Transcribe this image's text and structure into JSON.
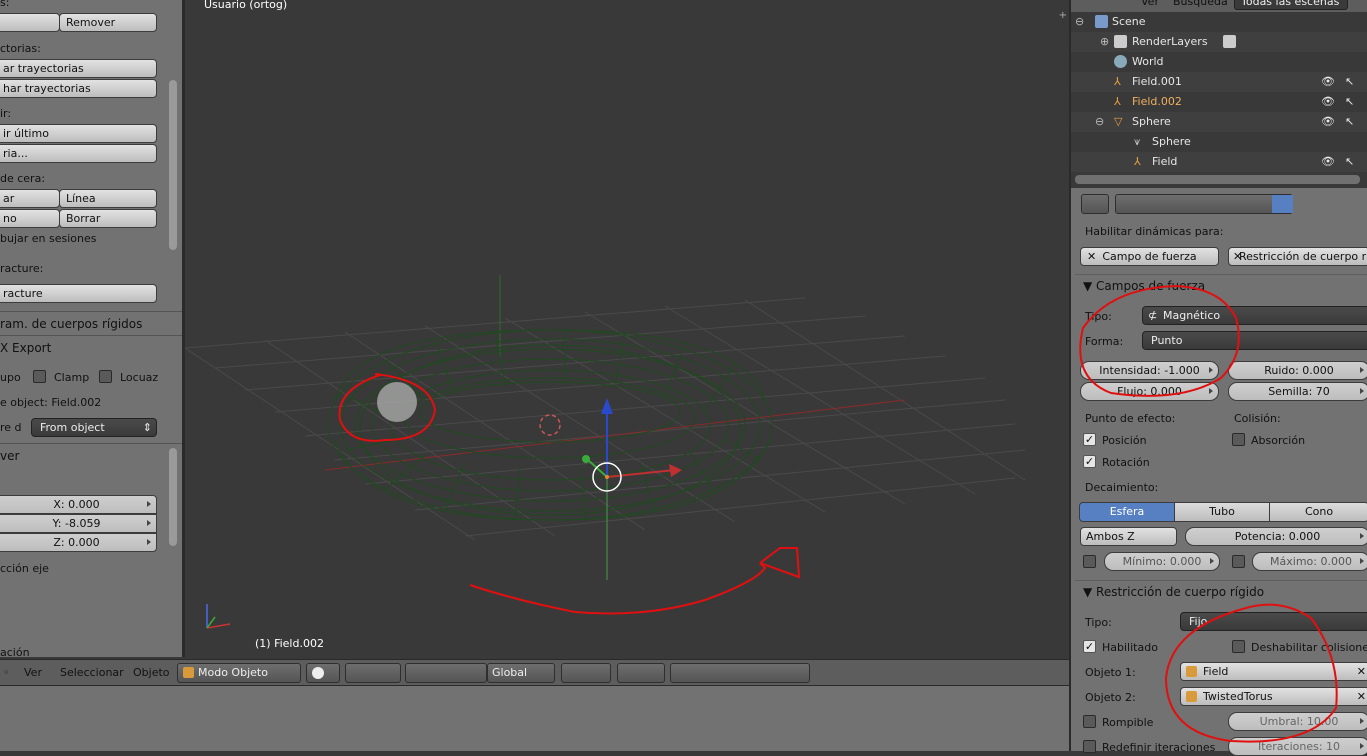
{
  "left_shelf": {
    "top_label": "s:",
    "remove_row": {
      "left": "",
      "right": "Remover"
    },
    "trajectories_label": "ctorias:",
    "traj_btn1": "ar trayectorias",
    "traj_btn2": "har trayectorias",
    "repeat_label": "ir:",
    "repeat_btn1": "ir último",
    "repeat_btn2": "ria...",
    "grease_label": "de cera:",
    "grease_row1": {
      "left": "ar",
      "right": "Línea"
    },
    "grease_row2": {
      "left": "no",
      "right": "Borrar"
    },
    "grease_sessions": "bujar en sesiones",
    "fracture_label": "racture:",
    "fracture_btn": "racture",
    "rigid_panel": "ram. de cuerpos rígidos",
    "export_panel": "X Export",
    "export_opts": {
      "a": "upo",
      "b": "Clamp",
      "c": "Locuaz"
    },
    "object_line": "e object: Field.002",
    "from_label": "re d",
    "from_value": "From object",
    "ver_panel": "ver",
    "x": "X: 0.000",
    "y": "Y: -8.059",
    "z": "Z: 0.000",
    "axis_label": "cción eje",
    "bottom_label": "ación"
  },
  "viewport": {
    "view_name": "Usuario (ortog)",
    "object_info": "(1) Field.002"
  },
  "header": {
    "menu_view": "Ver",
    "menu_select": "Seleccionar",
    "menu_object": "Objeto",
    "mode": "Modo Objeto",
    "orientation": "Global"
  },
  "outliner": {
    "top_view": "Ver",
    "top_search": "Búsqueda",
    "scene_filter": "Todas las escenas",
    "items": [
      {
        "label": "Scene",
        "icon": "scene-icon"
      },
      {
        "label": "RenderLayers",
        "icon": "renderlayers-icon"
      },
      {
        "label": "World",
        "icon": "world-icon"
      },
      {
        "label": "Field.001",
        "icon": "field-icon"
      },
      {
        "label": "Field.002",
        "icon": "field-icon"
      },
      {
        "label": "Sphere",
        "icon": "mesh-object-icon"
      },
      {
        "label": "Sphere",
        "icon": "mesh-data-icon"
      },
      {
        "label": "Field",
        "icon": "field-icon"
      }
    ]
  },
  "properties": {
    "enable_dynamics": "Habilitar dinámicas para:",
    "force_field_btn": "Campo de fuerza",
    "rigid_constraint_btn": "Restricción de cuerpo rígido",
    "force_fields_panel": "Campos de fuerza",
    "type_label": "Tipo:",
    "type_value": "Magnético",
    "shape_label": "Forma:",
    "shape_value": "Punto",
    "intensity": "Intensidad: -1.000",
    "noise": "Ruido: 0.000",
    "flow": "Flujo: 0.000",
    "seed": "Semilla: 70",
    "effect_point": "Punto de efecto:",
    "collision": "Colisión:",
    "position": "Posición",
    "rotation": "Rotación",
    "absorption": "Absorción",
    "falloff": "Decaimiento:",
    "falloff_tabs": [
      "Esfera",
      "Tubo",
      "Cono"
    ],
    "z_dir": "Ambos Z",
    "power": "Potencia: 0.000",
    "min": "Mínimo: 0.000",
    "max": "Máximo: 0.000",
    "rigid_panel": "Restricción de cuerpo rígido",
    "rtype_label": "Tipo:",
    "rtype_value": "Fijo",
    "enabled": "Habilitado",
    "disable_collisions": "Deshabilitar colisiones",
    "obj1_label": "Objeto 1:",
    "obj1_value": "Field",
    "obj2_label": "Objeto 2:",
    "obj2_value": "TwistedTorus",
    "breakable": "Rompible",
    "threshold": "Umbral: 10.00",
    "override_iter": "Redefinir iteraciones",
    "iterations": "Iteraciones: 10"
  },
  "colors": {
    "accent": "#5680c2",
    "annotation": "#e01010",
    "wire": "#1f4a1f"
  }
}
